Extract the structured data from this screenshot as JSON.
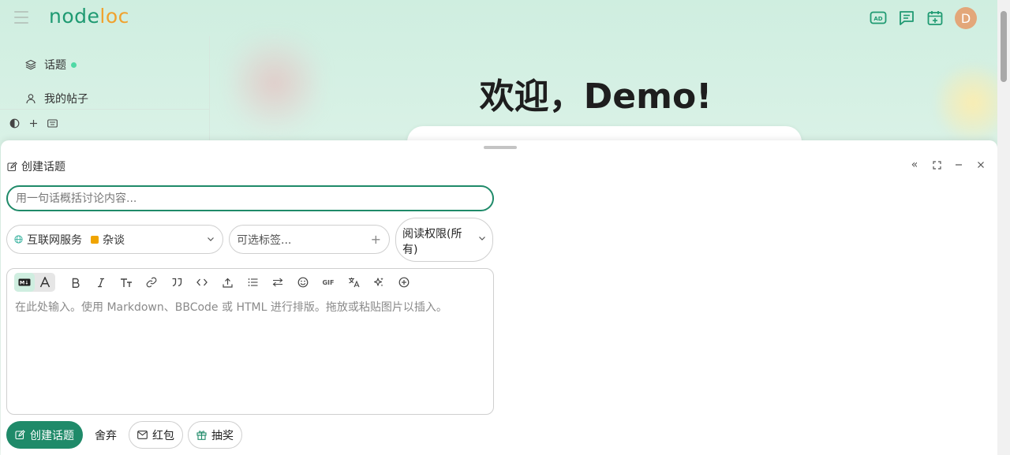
{
  "header": {
    "logo_part1": "node",
    "logo_part2": "loc",
    "avatar_letter": "D"
  },
  "sidebar": {
    "items": [
      {
        "label": "话题",
        "icon": "layers-icon",
        "unread_dot": true
      },
      {
        "label": "我的帖子",
        "icon": "user-icon"
      }
    ],
    "tools": [
      "theme-toggle-icon",
      "plus-icon",
      "keyboard-icon"
    ]
  },
  "main": {
    "welcome": "欢迎，Demo!"
  },
  "composer": {
    "title": "创建话题",
    "title_placeholder": "用一句话概括讨论内容...",
    "category": {
      "parent": "互联网服务",
      "child": "杂谈",
      "child_color": "#f0a400"
    },
    "tags_placeholder": "可选标签...",
    "read_permission": "阅读权限(所有)",
    "editor_placeholder": "在此处输入。使用 Markdown、BBCode 或 HTML 进行排版。拖放或粘贴图片以插入。",
    "buttons": {
      "create": "创建话题",
      "discard": "舍弃",
      "red_packet": "红包",
      "lottery": "抽奖"
    },
    "toolbar_gif": "GIF"
  },
  "colors": {
    "brand": "#1f8a69",
    "accent": "#f0a22e"
  }
}
